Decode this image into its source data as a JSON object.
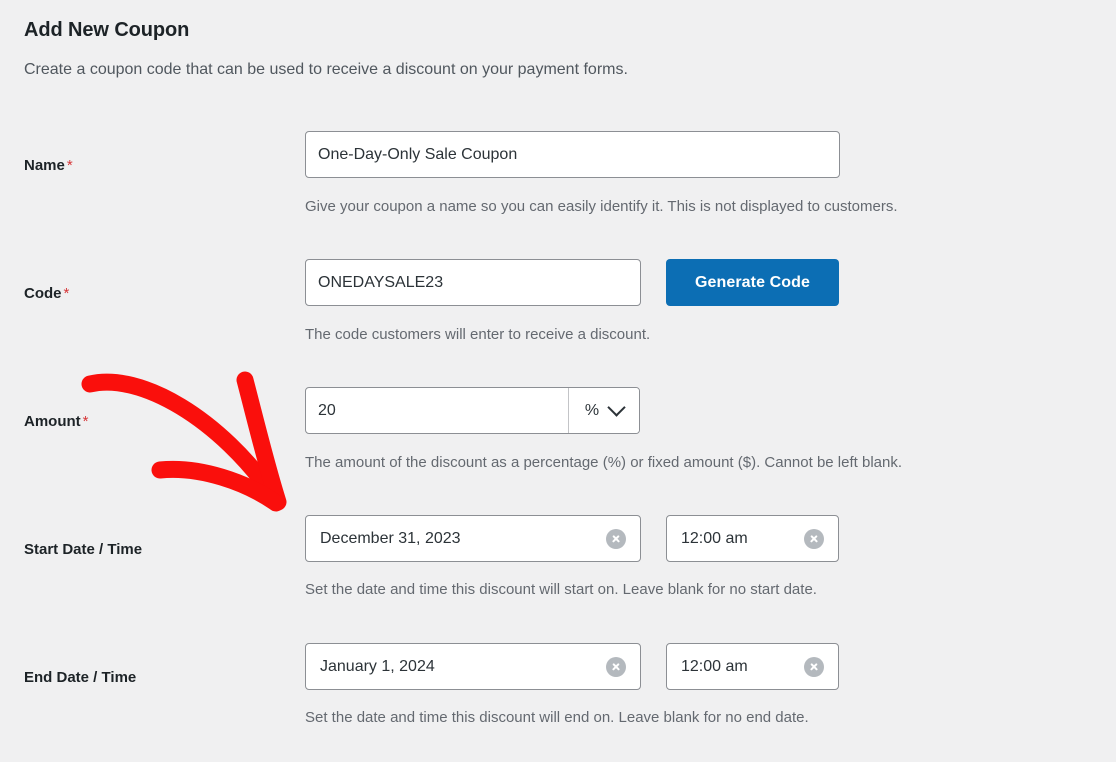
{
  "header": {
    "title": "Add New Coupon",
    "subtitle": "Create a coupon code that can be used to receive a discount on your payment forms."
  },
  "colors": {
    "page_background": "#f0f0f1",
    "primary_button": "#0c6eb4",
    "required_asterisk": "#d63638",
    "annotation_arrow": "#fa0f0c",
    "input_border": "#8c8f94",
    "help_text": "#646970",
    "label_text": "#1d2327"
  },
  "fields": {
    "name": {
      "label": "Name",
      "required_marker": "*",
      "value": "One-Day-Only Sale Coupon",
      "placeholder": "",
      "help": "Give your coupon a name so you can easily identify it. This is not displayed to customers."
    },
    "code": {
      "label": "Code",
      "required_marker": "*",
      "value": "ONEDAYSALE23",
      "placeholder": "",
      "help": "The code customers will enter to receive a discount.",
      "generate_button_label": "Generate Code"
    },
    "amount": {
      "label": "Amount",
      "required_marker": "*",
      "value": "20",
      "placeholder": "",
      "type_selected": "%",
      "type_options": [
        "%",
        "$"
      ],
      "help": "The amount of the discount as a percentage (%) or fixed amount ($). Cannot be left blank."
    },
    "start_date_time": {
      "label": "Start Date / Time",
      "date_value": "December 31, 2023",
      "date_placeholder": "",
      "time_value": "12:00 am",
      "time_placeholder": "",
      "help": "Set the date and time this discount will start on. Leave blank for no start date."
    },
    "end_date_time": {
      "label": "End Date / Time",
      "date_value": "January 1, 2024",
      "date_placeholder": "",
      "time_value": "12:00 am",
      "time_placeholder": "",
      "help": "Set the date and time this discount will end on. Leave blank for no end date."
    }
  },
  "icons": {
    "clear_start_date": "clear-circle-x-icon",
    "clear_start_time": "clear-circle-x-icon",
    "clear_end_date": "clear-circle-x-icon",
    "clear_end_time": "clear-circle-x-icon",
    "amount_type_chevron": "chevron-down-icon"
  },
  "annotation": {
    "type": "red-curved-arrow",
    "points_to": "start-date-field"
  }
}
